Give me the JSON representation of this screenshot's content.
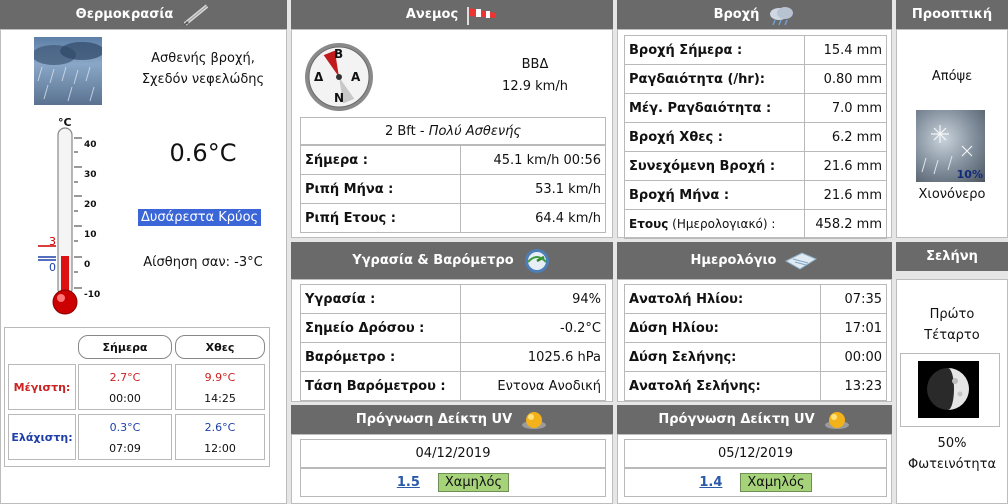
{
  "temperature": {
    "header": "Θερμοκρασία",
    "condition_line1": "Ασθενής βροχή,",
    "condition_line2": "Σχεδόν νεφελώδης",
    "current": "0.6°C",
    "feel_badge": "Δυσάρεστα Κρύος",
    "feels_like": "Αίσθηση σαν: -3°C",
    "thermo_unit": "°C",
    "thermo_ticks": [
      "40",
      "30",
      "20",
      "10",
      "0",
      "-10"
    ],
    "marker_high": "3",
    "marker_low": "0",
    "table_today": "Σήμερα",
    "table_yesterday": "Χθες",
    "max_label": "Μέγιστη:",
    "min_label": "Ελάχιστη:",
    "max_today_val": "2.7°C",
    "max_today_time": "00:00",
    "max_yest_val": "9.9°C",
    "max_yest_time": "14:25",
    "min_today_val": "0.3°C",
    "min_today_time": "07:09",
    "min_yest_val": "2.6°C",
    "min_yest_time": "12:00",
    "colors": {
      "max": "#cc2222",
      "min": "#1e3fa8",
      "badge": "#3a66d8"
    }
  },
  "wind": {
    "header": "Ανεμος",
    "compass_n": "Β",
    "compass_s": "Ν",
    "compass_w": "Δ",
    "compass_e": "Α",
    "direction": "ΒΒΔ",
    "speed": "12.9 km/h",
    "beaufort_num": "2 Bft",
    "beaufort_sep": " - ",
    "beaufort_text": "Πολύ Ασθενής",
    "rows": [
      {
        "label": "Σήμερα :",
        "value": "45.1 km/h 00:56"
      },
      {
        "label": "Ριπή Μήνα :",
        "value": "53.1 km/h"
      },
      {
        "label": "Ριπή Ετους :",
        "value": "64.4 km/h"
      }
    ]
  },
  "rain": {
    "header": "Βροχή",
    "rows": [
      {
        "label": "Βροχή Σήμερα :",
        "value": "15.4 mm"
      },
      {
        "label": "Ραγδαιότητα (/hr):",
        "value": "0.80 mm"
      },
      {
        "label": "Μέγ. Ραγδαιότητα :",
        "value": "7.0 mm"
      },
      {
        "label": "Βροχή Χθες :",
        "value": "6.2 mm"
      },
      {
        "label": "Συνεχόμενη Βροχή :",
        "value": "21.6 mm"
      },
      {
        "label": "Βροχή Μήνα :",
        "value": "21.6 mm"
      }
    ],
    "year_label_bold": "Ετους",
    "year_label_rest": " (Ημερολογιακό) :",
    "year_value": "458.2 mm"
  },
  "forecast": {
    "header": "Προοπτική",
    "when": "Απόψε",
    "badge": "10%",
    "desc": "Χιονόνερο"
  },
  "humidity": {
    "header": "Υγρασία & Βαρόμετρο",
    "rows": [
      {
        "label": "Υγρασία :",
        "value": "94%"
      },
      {
        "label": "Σημείο Δρόσου :",
        "value": "-0.2°C"
      },
      {
        "label": "Βαρόμετρο :",
        "value": "1025.6 hPa"
      },
      {
        "label": "Τάση Βαρόμετρου :",
        "value": "Εντονα Ανοδική"
      }
    ]
  },
  "almanac": {
    "header": "Ημερολόγιο",
    "rows": [
      {
        "label": "Ανατολή Ηλίου:",
        "value": "07:35"
      },
      {
        "label": "Δύση Ηλίου:",
        "value": "17:01"
      },
      {
        "label": "Δύση Σελήνης:",
        "value": "00:00"
      },
      {
        "label": "Ανατολή Σελήνης:",
        "value": "13:23"
      }
    ]
  },
  "moon": {
    "header": "Σελήνη",
    "phase_line1": "Πρώτο",
    "phase_line2": "Τέταρτο",
    "illum_pct": "50%",
    "illum_label": "Φωτεινότητα"
  },
  "uv1": {
    "header": "Πρόγνωση Δείκτη UV",
    "date": "04/12/2019",
    "index": "1.5",
    "level": "Χαμηλός"
  },
  "uv2": {
    "header": "Πρόγνωση Δείκτη UV",
    "date": "05/12/2019",
    "index": "1.4",
    "level": "Χαμηλός"
  }
}
